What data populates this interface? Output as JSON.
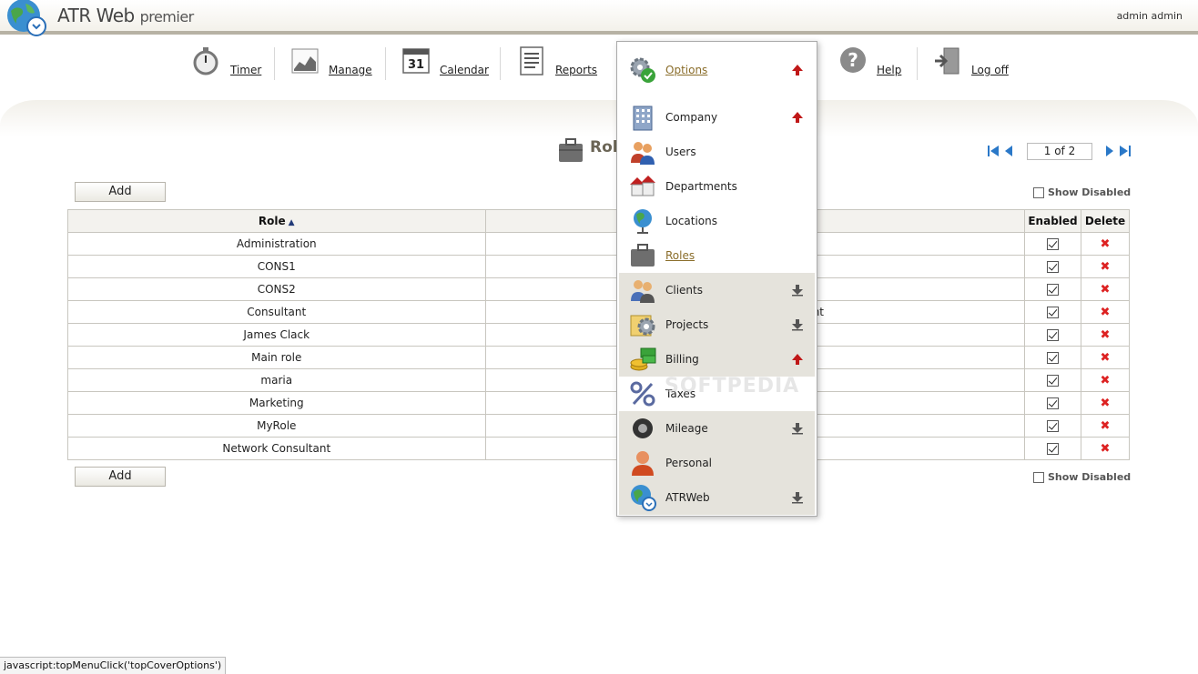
{
  "header": {
    "app_name": "ATR Web",
    "app_edition": "premier",
    "user": "admin admin"
  },
  "nav": [
    {
      "label": "Timer",
      "icon": "stopwatch-icon"
    },
    {
      "label": "Manage",
      "icon": "chart-icon"
    },
    {
      "label": "Calendar",
      "icon": "calendar-icon",
      "day": "31"
    },
    {
      "label": "Reports",
      "icon": "report-icon"
    },
    {
      "label": "Help",
      "icon": "help-icon"
    },
    {
      "label": "Log off",
      "icon": "logoff-icon"
    }
  ],
  "page": {
    "title": "Roles",
    "pager": {
      "current": "1 of 2"
    },
    "add_label": "Add",
    "show_disabled_label": "Show Disabled"
  },
  "grid": {
    "columns": [
      "Role",
      "",
      "Enabled",
      "Delete"
    ],
    "rows": [
      {
        "role": "Administration",
        "desc": "",
        "enabled": true
      },
      {
        "role": "CONS1",
        "desc": "",
        "enabled": true
      },
      {
        "role": "CONS2",
        "desc": "",
        "enabled": true
      },
      {
        "role": "Consultant",
        "desc": "nt",
        "enabled": true
      },
      {
        "role": "James Clack",
        "desc": "",
        "enabled": true
      },
      {
        "role": "Main role",
        "desc": "",
        "enabled": true
      },
      {
        "role": "maria",
        "desc": "",
        "enabled": true
      },
      {
        "role": "Marketing",
        "desc": "",
        "enabled": true
      },
      {
        "role": "MyRole",
        "desc": "",
        "enabled": true
      },
      {
        "role": "Network Consultant",
        "desc": "",
        "enabled": true
      }
    ]
  },
  "dropdown": {
    "items": [
      {
        "label": "Options",
        "icon": "options-gear-icon",
        "arrow": "up"
      },
      {
        "label": "Company",
        "icon": "building-icon",
        "arrow": "up"
      },
      {
        "label": "Users",
        "icon": "users-icon",
        "arrow": ""
      },
      {
        "label": "Departments",
        "icon": "departments-icon",
        "arrow": ""
      },
      {
        "label": "Locations",
        "icon": "globe-icon",
        "arrow": ""
      },
      {
        "label": "Roles",
        "icon": "briefcase-icon",
        "arrow": ""
      },
      {
        "label": "Clients",
        "icon": "clients-icon",
        "arrow": "down"
      },
      {
        "label": "Projects",
        "icon": "projects-icon",
        "arrow": "down"
      },
      {
        "label": "Billing",
        "icon": "billing-icon",
        "arrow": "up"
      },
      {
        "label": "Taxes",
        "icon": "percent-icon",
        "arrow": ""
      },
      {
        "label": "Mileage",
        "icon": "tire-icon",
        "arrow": "down"
      },
      {
        "label": "Personal",
        "icon": "person-icon",
        "arrow": ""
      },
      {
        "label": "ATRWeb",
        "icon": "atrweb-globe-icon",
        "arrow": "down"
      }
    ]
  },
  "watermark": "SOFTPEDIA",
  "status_text": "javascript:topMenuClick('topCoverOptions')",
  "colors": {
    "link": "#8a6d2a",
    "delete": "#dd2222",
    "header_bar": "#b7b2a4"
  }
}
